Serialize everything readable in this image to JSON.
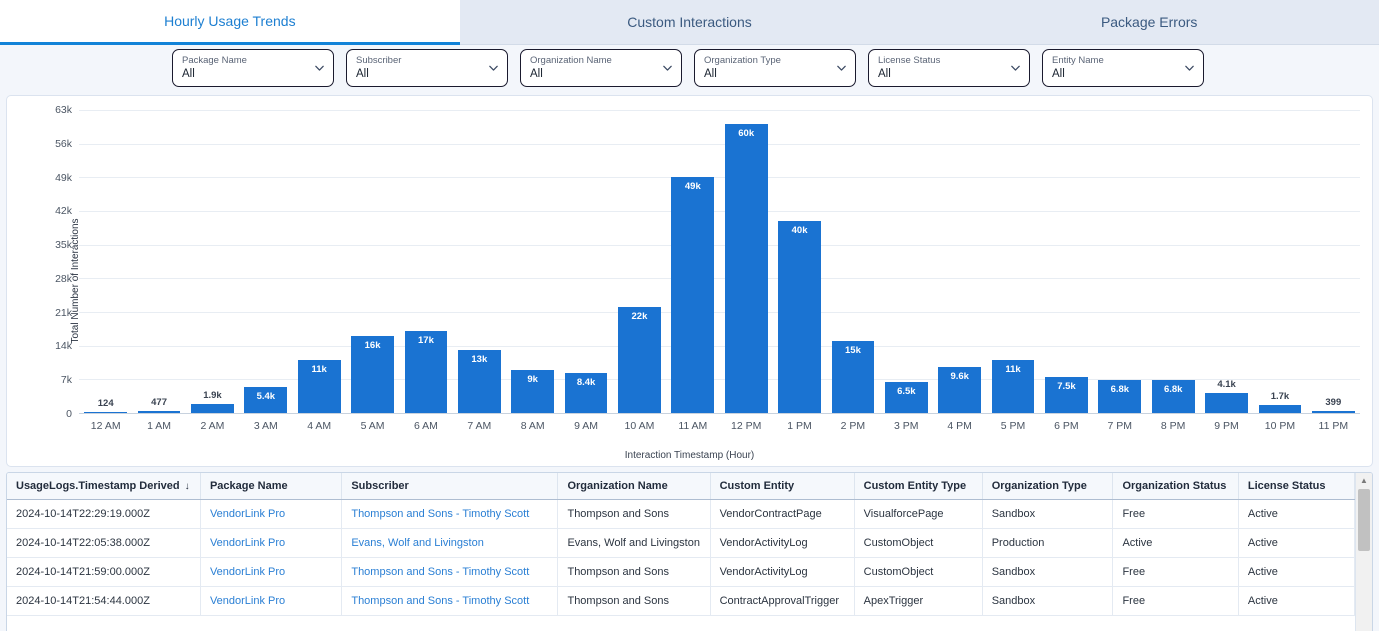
{
  "tabs": [
    {
      "label": "Hourly Usage Trends",
      "active": true
    },
    {
      "label": "Custom Interactions",
      "active": false
    },
    {
      "label": "Package Errors",
      "active": false
    }
  ],
  "filters": [
    {
      "label": "Package Name",
      "value": "All"
    },
    {
      "label": "Subscriber",
      "value": "All"
    },
    {
      "label": "Organization Name",
      "value": "All"
    },
    {
      "label": "Organization Type",
      "value": "All"
    },
    {
      "label": "License Status",
      "value": "All"
    },
    {
      "label": "Entity Name",
      "value": "All"
    }
  ],
  "chart_data": {
    "type": "bar",
    "title": "",
    "xlabel": "Interaction Timestamp (Hour)",
    "ylabel": "Total Number of Interactions",
    "ylim": [
      0,
      63000
    ],
    "yticks": [
      0,
      7000,
      14000,
      21000,
      28000,
      35000,
      42000,
      49000,
      56000,
      63000
    ],
    "ytick_labels": [
      "0",
      "7k",
      "14k",
      "21k",
      "28k",
      "35k",
      "42k",
      "49k",
      "56k",
      "63k"
    ],
    "grid": true,
    "legend": "none",
    "bar_color": "#1a73d2",
    "categories": [
      "12 AM",
      "1 AM",
      "2 AM",
      "3 AM",
      "4 AM",
      "5 AM",
      "6 AM",
      "7 AM",
      "8 AM",
      "9 AM",
      "10 AM",
      "11 AM",
      "12 PM",
      "1 PM",
      "2 PM",
      "3 PM",
      "4 PM",
      "5 PM",
      "6 PM",
      "7 PM",
      "8 PM",
      "9 PM",
      "10 PM",
      "11 PM"
    ],
    "values": [
      124,
      477,
      1900,
      5400,
      11000,
      16000,
      17000,
      13000,
      9000,
      8400,
      22000,
      49000,
      60000,
      40000,
      15000,
      6500,
      9600,
      11000,
      7500,
      6800,
      6800,
      4100,
      1700,
      399
    ],
    "data_labels": [
      "124",
      "477",
      "1.9k",
      "5.4k",
      "11k",
      "16k",
      "17k",
      "13k",
      "9k",
      "8.4k",
      "22k",
      "49k",
      "60k",
      "40k",
      "15k",
      "6.5k",
      "9.6k",
      "11k",
      "7.5k",
      "6.8k",
      "6.8k",
      "4.1k",
      "1.7k",
      "399"
    ]
  },
  "table": {
    "columns": [
      "UsageLogs.Timestamp Derived",
      "Package Name",
      "Subscriber",
      "Organization Name",
      "Custom Entity",
      "Custom Entity Type",
      "Organization Type",
      "Organization Status",
      "License Status"
    ],
    "sort_column_index": 0,
    "sort_arrow": "↓",
    "rows": [
      {
        "timestamp": "2024-10-14T22:29:19.000Z",
        "package_name": "VendorLink Pro",
        "subscriber": "Thompson and Sons - Timothy Scott",
        "organization_name": "Thompson and Sons",
        "custom_entity": "VendorContractPage",
        "custom_entity_type": "VisualforcePage",
        "organization_type": "Sandbox",
        "organization_status": "Free",
        "license_status": "Active"
      },
      {
        "timestamp": "2024-10-14T22:05:38.000Z",
        "package_name": "VendorLink Pro",
        "subscriber": "Evans, Wolf and Livingston",
        "organization_name": "Evans, Wolf and Livingston",
        "custom_entity": "VendorActivityLog",
        "custom_entity_type": "CustomObject",
        "organization_type": "Production",
        "organization_status": "Active",
        "license_status": "Active"
      },
      {
        "timestamp": "2024-10-14T21:59:00.000Z",
        "package_name": "VendorLink Pro",
        "subscriber": "Thompson and Sons - Timothy Scott",
        "organization_name": "Thompson and Sons",
        "custom_entity": "VendorActivityLog",
        "custom_entity_type": "CustomObject",
        "organization_type": "Sandbox",
        "organization_status": "Free",
        "license_status": "Active"
      },
      {
        "timestamp": "2024-10-14T21:54:44.000Z",
        "package_name": "VendorLink Pro",
        "subscriber": "Thompson and Sons - Timothy Scott",
        "organization_name": "Thompson and Sons",
        "custom_entity": "ContractApprovalTrigger",
        "custom_entity_type": "ApexTrigger",
        "organization_type": "Sandbox",
        "organization_status": "Free",
        "license_status": "Active"
      }
    ]
  }
}
